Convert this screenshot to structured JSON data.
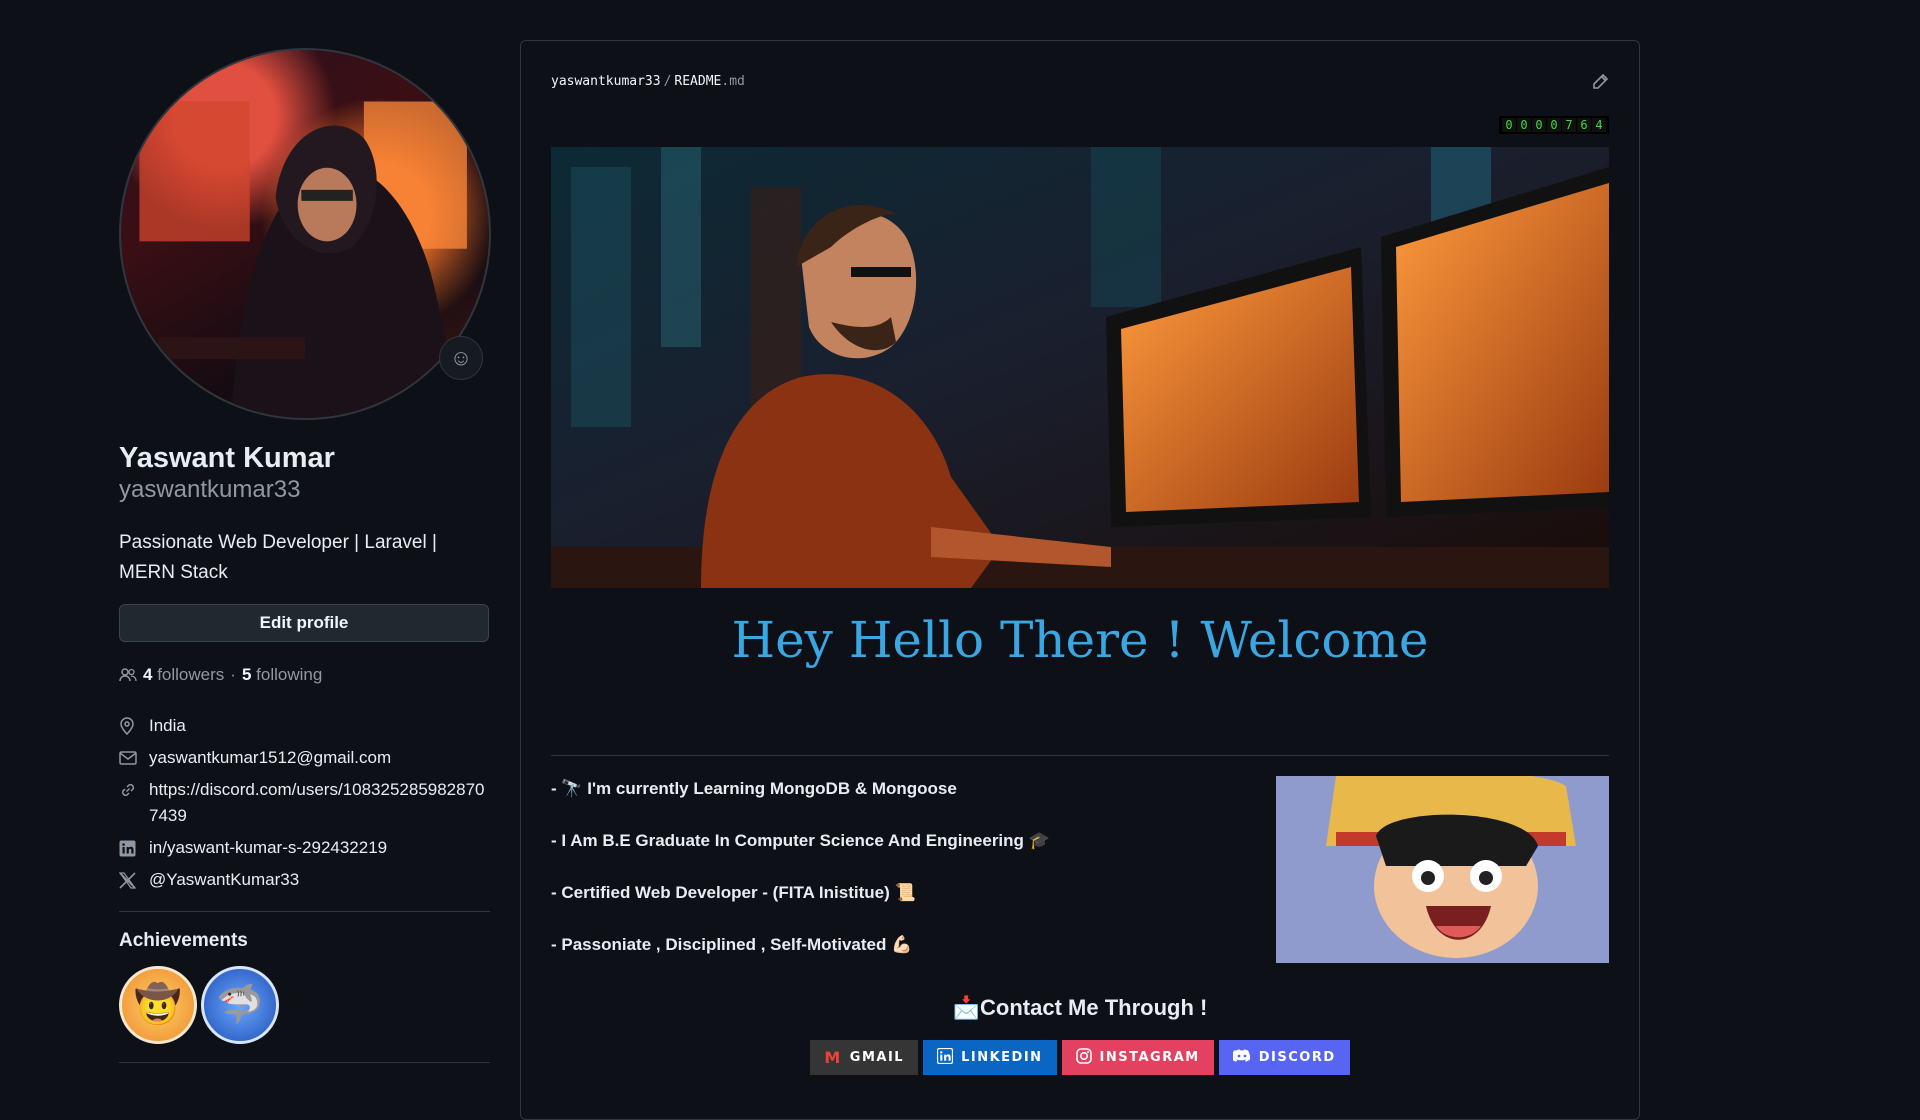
{
  "profile": {
    "name": "Yaswant Kumar",
    "login": "yaswantkumar33",
    "bio": "Passionate Web Developer | Laravel | MERN Stack",
    "edit_profile_label": "Edit profile",
    "followers_count": "4",
    "followers_label": "followers",
    "dot": "·",
    "following_count": "5",
    "following_label": "following",
    "details": {
      "location": "India",
      "email": "yaswantkumar1512@gmail.com",
      "website": "https://discord.com/users/1083252859828707439",
      "linkedin": "in/yaswant-kumar-s-292432219",
      "twitter": "@YaswantKumar33"
    },
    "achievements_title": "Achievements",
    "icons": {
      "avatar_status": "smiley-icon",
      "people": "people-icon",
      "location": "location-icon",
      "email": "mail-icon",
      "link": "link-icon",
      "linkedin": "linkedin-icon",
      "twitter": "x-icon"
    }
  },
  "readme": {
    "owner": "yaswantkumar33",
    "separator": "/",
    "file_base": "README",
    "file_ext": ".md",
    "counter_digits": [
      "0",
      "0",
      "0",
      "0",
      "7",
      "6",
      "4"
    ],
    "greeting": "Hey Hello There ! Welcome",
    "bullets": [
      "- 🔭 I'm currently Learning MongoDB & Mongoose",
      "- I Am B.E Graduate In Computer Science And Engineering 🎓",
      "- Certified Web Developer - (FITA Inistitue) 📜",
      "- Passoniate , Disciplined , Self-Motivated 💪🏻"
    ],
    "contact_title": "📩Contact Me Through !",
    "buttons": {
      "gmail": "GMAIL",
      "linkedin": "LINKEDIN",
      "instagram": "INSTAGRAM",
      "discord": "DISCORD"
    }
  },
  "colors": {
    "background": "#0d1117",
    "greeting": "#3aa7e2",
    "gmail": "#353535",
    "linkedin": "#0a66c2",
    "instagram": "#e4405f",
    "discord": "#5865f2"
  }
}
